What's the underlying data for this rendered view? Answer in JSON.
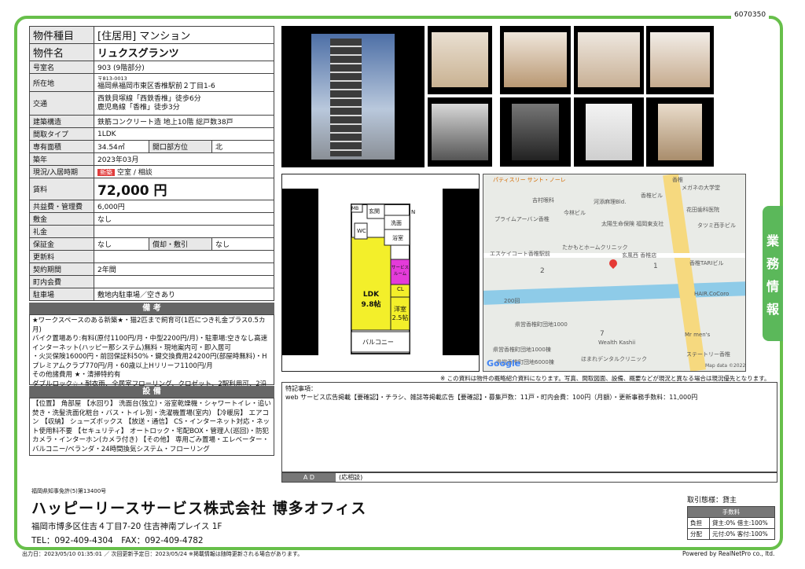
{
  "code": "6070350",
  "side_tab": [
    "業",
    "務",
    "情",
    "報"
  ],
  "props": {
    "type_label": "物件種目",
    "type_value": "[住居用] マンション",
    "name_label": "物件名",
    "name_value": "リュクスグランツ",
    "room_label": "号室名",
    "room_value": "903 (9階部分)",
    "addr_label": "所在地",
    "zip": "〒813-0013",
    "addr_value": "福岡県福岡市東区香椎駅前２丁目1-6",
    "traffic_label": "交通",
    "traffic1": "西鉄貝塚線「西鉄香椎」徒歩6分",
    "traffic2": "鹿児島線「香椎」徒歩3分",
    "struct_label": "建築構造",
    "struct_value": "鉄筋コンクリート造 地上10階 総戸数38戸",
    "layout_label": "間取タイプ",
    "layout_value": "1LDK",
    "area_label": "専有面積",
    "area_value": "34.54㎡",
    "dir_label": "開口部方位",
    "dir_value": "北",
    "built_label": "築年",
    "built_value": "2023年03月",
    "status_label": "現況/入居時期",
    "status_new": "新築",
    "status_value": "空室 / 相談",
    "rent_label": "賃料",
    "rent_value": "72,000 円",
    "fee_label": "共益費・管理費",
    "fee_value": "6,000円",
    "shiki_label": "敷金",
    "shiki_value": "なし",
    "rei_label": "礼金",
    "rei_value": "",
    "hosho_label": "保証金",
    "hosho_value": "なし",
    "shokyaku_label": "償却・敷引",
    "shokyaku_value": "なし",
    "koshin_label": "更新料",
    "koshin_value": "",
    "kikan_label": "契約期間",
    "kikan_value": "2年間",
    "chonai_label": "町内会費",
    "chonai_value": "",
    "parking_label": "駐車場",
    "parking_value": "敷地内駐車場／空きあり"
  },
  "remarks": {
    "title": "備 考",
    "text": "★ワークスペースのある新築★・猫2匹まで飼育可(1匹につき礼金プラス0.5カ月)\nバイク置場あり:有料(原付1100円/月・中型2200円/月)・駐車場:空きなし高速インターネット(ハッピー那システム)無料・現地案内可・即入居可\n・火災保険16000円・前回保証料50%・鍵交換費用24200円(部屋時無料)・Hプレミアムクラブ770円/月・60歳以上Hリリーフ1100円/月\nその他諸費用 ★・清掃特約有\nダブルロック☆・耐衣雨、全居室フローリング、クロゼット、2駅利用可、2沿線利用可"
  },
  "equipment": {
    "title": "設 備",
    "text": "【位置】 角部屋 【水回り】 洗面台(独立)・浴室乾燥機・シャワートイレ・追い焚き・洗髪洗面化粧台・バス・トイレ別・洗濯機置場(室内) 【冷暖房】 エアコン 【収納】 シューズボックス 【放送・通信】 CS・インターネット対応・ネット使用料不要 【セキュリティ】 オートロック・宅配BOX・管理人(巡回)・防犯カメラ・インターホン(カメラ付き) 【その他】 専用ごみ置場・エレベーター・バルコニー/ベランダ・24時間換気システム・フローリング"
  },
  "floorplan": {
    "mb": "MB",
    "entrance": "玄関",
    "washroom": "洗面",
    "wc": "WC",
    "bath": "浴室",
    "service": "サービスルーム",
    "ldk": "LDK\n9.8帖",
    "cl": "CL",
    "western": "洋室\n2.5帖",
    "balcony": "バルコニー",
    "north": "N"
  },
  "map": {
    "labels": [
      "パティスリー サント・ノーレ",
      "香椎",
      "メガネの大学堂",
      "吉村眼科",
      "河添麻理Bld.",
      "香椎ビル",
      "今林ビル",
      "花田歯科医院",
      "プライムアーバン香椎",
      "太陽生命保険 福岡東支社",
      "タツミ西手ビル",
      "エスケイコート香椎駅前",
      "たかもとホームクリニック",
      "玄風西 香椎店",
      "香椎TARIビル",
      "2",
      "1",
      "HAIR.CoCoro",
      "200回",
      "県営香椎町団地1000",
      "7",
      "Wealth Kashii",
      "Mr men's",
      "県営香椎町団地1000棟",
      "ステートリー香椎",
      "ほまれデンタルクリニック",
      "県営香椎町団地6000棟",
      "Map data ©2022"
    ],
    "google": "Google"
  },
  "notice": "※ この資料は物件の概略紹介資料になります。写真、間取図面、設備、概要などが現況と異なる場合は現況優先となります。",
  "special": {
    "title": "特記事項：",
    "text": "web サービス広告掲載【要確認】・チラシ、雑誌等掲載広告【要確認】・募集戸数：11戸・町内会費：100円（月額）・更新事務手数料：11,000円"
  },
  "ad": {
    "label": "A D",
    "value": "(応相談)"
  },
  "company": {
    "license": "福岡県知事免許(5)第13400号",
    "name": "ハッピーリースサービス株式会社 博多オフィス",
    "address": "福岡市博多区住吉４丁目7-20 住吉神南プレイス 1F",
    "tel": "TEL：092-409-4304　FAX：092-409-4782"
  },
  "transaction": {
    "title": "取引態様：貸主",
    "fee_header": "手数料",
    "row1_label": "負担",
    "row1_value": "貸主:0% 借主:100%",
    "row2_label": "分配",
    "row2_value": "元付:0% 客付:100%"
  },
  "footer": "出力日：2023/05/10 01:35:01 ／ 次回更新予定日：2023/05/24 ※掲載情報は随時更新される場合があります。",
  "powered": "Powered by RealNetPro co., ltd.",
  "colors": {
    "frame": "#67bf4a",
    "tab": "#5bb85a",
    "new_tag": "#e03c3c",
    "ldk": "#f3ef2a",
    "service": "#e43bd9"
  }
}
